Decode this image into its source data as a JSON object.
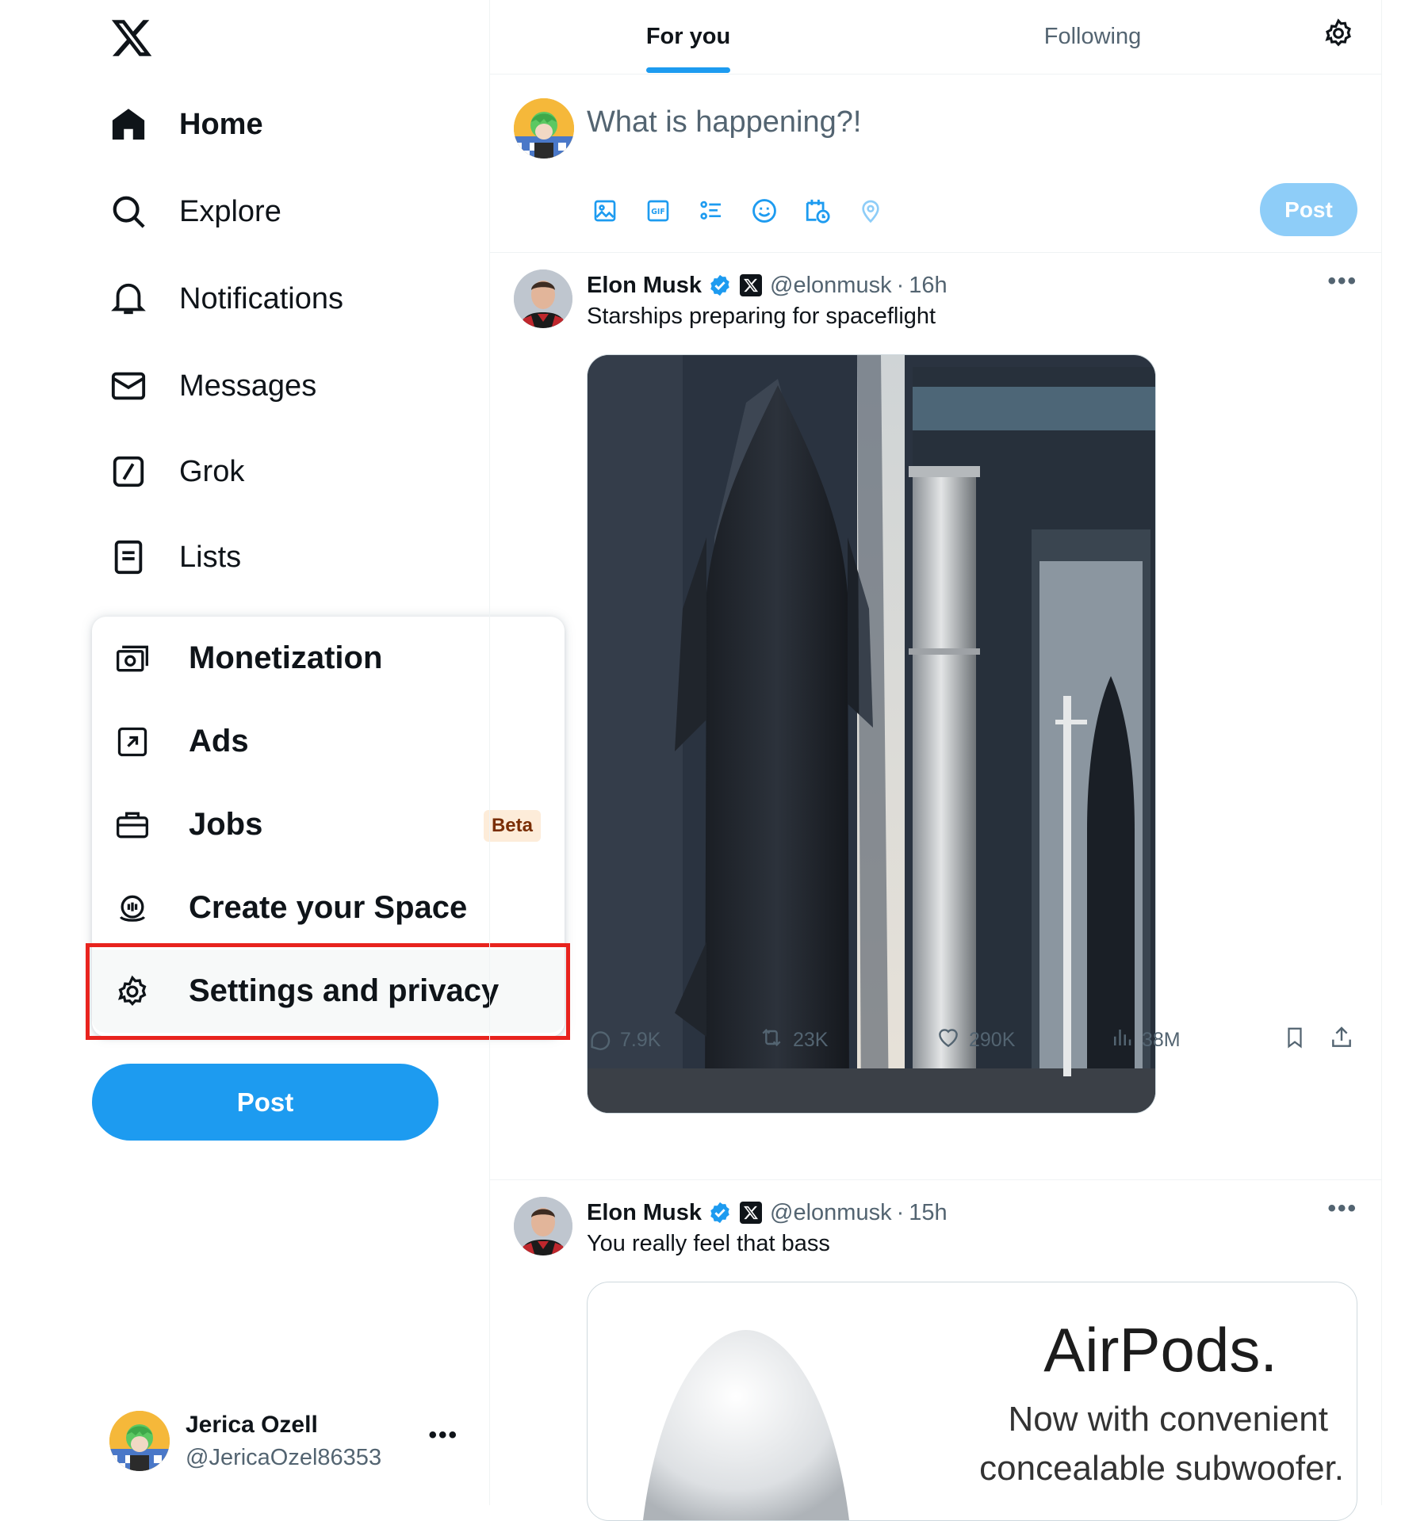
{
  "nav": {
    "items": [
      {
        "label": "Home",
        "icon": "home-icon",
        "active": true
      },
      {
        "label": "Explore",
        "icon": "search-icon"
      },
      {
        "label": "Notifications",
        "icon": "bell-icon"
      },
      {
        "label": "Messages",
        "icon": "mail-icon"
      },
      {
        "label": "Grok",
        "icon": "grok-icon"
      },
      {
        "label": "Lists",
        "icon": "list-icon"
      }
    ],
    "menu": [
      {
        "label": "Monetization",
        "icon": "money-icon"
      },
      {
        "label": "Ads",
        "icon": "ads-arrow-icon"
      },
      {
        "label": "Jobs",
        "icon": "briefcase-icon",
        "badge": "Beta"
      },
      {
        "label": "Create your Space",
        "icon": "space-mic-icon"
      },
      {
        "label": "Settings and privacy",
        "icon": "gear-icon"
      }
    ],
    "post_label": "Post",
    "account": {
      "name": "Jerica Ozell",
      "handle": "@JericaOzel86353"
    }
  },
  "tabs": {
    "for_you": "For you",
    "following": "Following"
  },
  "composer": {
    "placeholder": "What is happening?!",
    "post_label": "Post",
    "tools": [
      "image-icon",
      "gif-icon",
      "poll-icon",
      "emoji-icon",
      "schedule-icon",
      "location-icon"
    ]
  },
  "tweets": [
    {
      "name": "Elon Musk",
      "handle": "@elonmusk",
      "time": "16h",
      "text": "Starships preparing for spaceflight",
      "replies": "7.9K",
      "reposts": "23K",
      "likes": "290K",
      "views": "38M"
    },
    {
      "name": "Elon Musk",
      "handle": "@elonmusk",
      "time": "15h",
      "text": "You really feel that bass",
      "ad_title": "AirPods.",
      "ad_line1": "Now with convenient",
      "ad_line2": "concealable subwoofer."
    }
  ],
  "colors": {
    "accent": "#1d9bf0",
    "text": "#0f1419",
    "muted": "#536471",
    "highlight": "#e8231e"
  }
}
